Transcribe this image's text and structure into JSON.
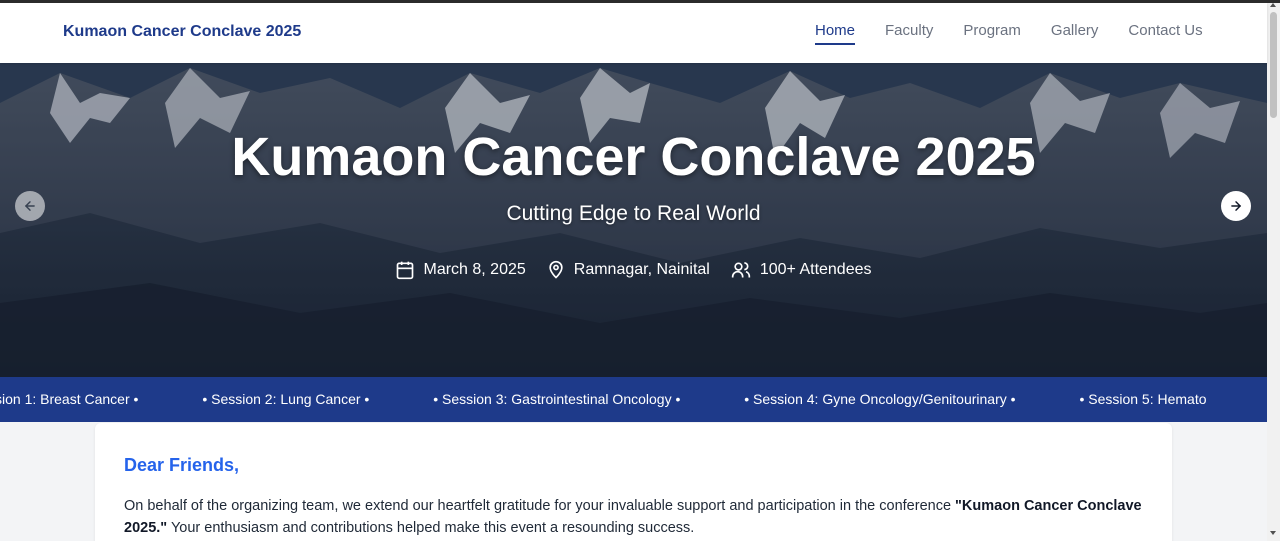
{
  "brand": "Kumaon Cancer Conclave 2025",
  "nav": {
    "home": "Home",
    "faculty": "Faculty",
    "program": "Program",
    "gallery": "Gallery",
    "contact": "Contact Us"
  },
  "hero": {
    "title": "Kumaon Cancer Conclave 2025",
    "subtitle": "Cutting Edge to Real World",
    "date": "March 8, 2025",
    "location": "Ramnagar, Nainital",
    "attendees": "100+ Attendees",
    "icons": [
      "calendar-icon",
      "map-pin-icon",
      "users-icon",
      "arrow-left-icon",
      "arrow-right-icon"
    ]
  },
  "ticker": {
    "items": [
      "ssion 1: Breast Cancer •",
      "• Session 2: Lung Cancer •",
      "• Session 3: Gastrointestinal Oncology •",
      "• Session 4: Gyne Oncology/Genitourinary •",
      "• Session 5: Hemato"
    ]
  },
  "letter": {
    "greeting": "Dear Friends,",
    "text_before": "On behalf of the organizing team, we extend our heartfelt gratitude for your invaluable support and participation in the conference ",
    "conference_name": "\"Kumaon Cancer Conclave 2025.\"",
    "text_after": " Your enthusiasm and contributions helped make this event a resounding success."
  },
  "colors": {
    "brand": "#1e3a8a",
    "ticker_bg": "#1e3a8a",
    "greeting": "#2563eb"
  }
}
